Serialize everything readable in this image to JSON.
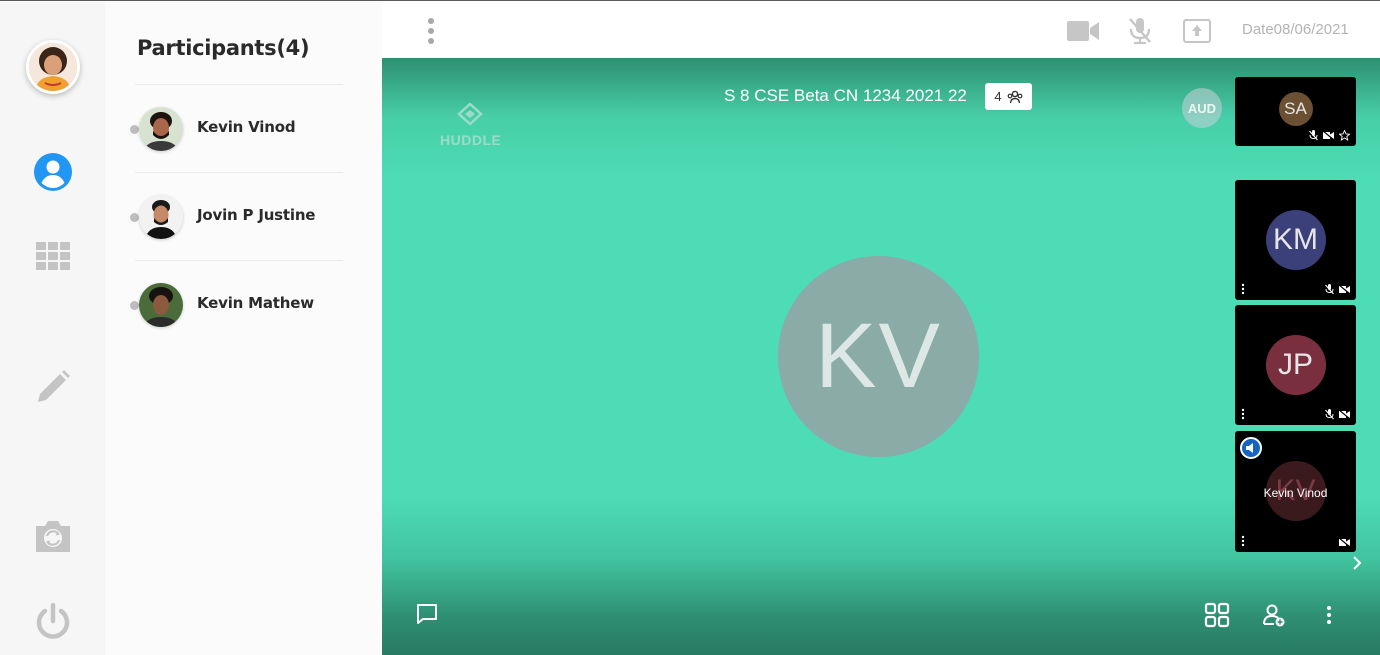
{
  "sidebar": {
    "icons": [
      "profile-avatar",
      "user-icon",
      "grid-icon",
      "pencil-icon",
      "camera-switch-icon",
      "power-icon"
    ]
  },
  "participants": {
    "title": "Participants(4)",
    "items": [
      {
        "name": "Kevin Vinod"
      },
      {
        "name": "Jovin P Justine"
      },
      {
        "name": "Kevin Mathew"
      }
    ]
  },
  "topbar": {
    "date": "Date08/06/2021",
    "icons": [
      "kebab-menu-icon",
      "video-camera-icon",
      "mic-off-icon",
      "screen-share-icon"
    ]
  },
  "stage": {
    "brand": "HUDDLE",
    "meeting_title": "S 8 CSE Beta CN 1234 2021 22",
    "participant_count": "4",
    "aud_label": "AUD",
    "main_initials": "KV"
  },
  "tiles": [
    {
      "initials": "SA",
      "color": "#6b5033"
    },
    {
      "initials": "KM",
      "color": "#3b3f7a"
    },
    {
      "initials": "JP",
      "color": "#7a2f3f"
    },
    {
      "initials": "KV",
      "color": "#3b1a1e",
      "label": "Kevin Vinod"
    }
  ],
  "colors": {
    "accent": "#2196f3",
    "stage": "#4ddcb4"
  }
}
